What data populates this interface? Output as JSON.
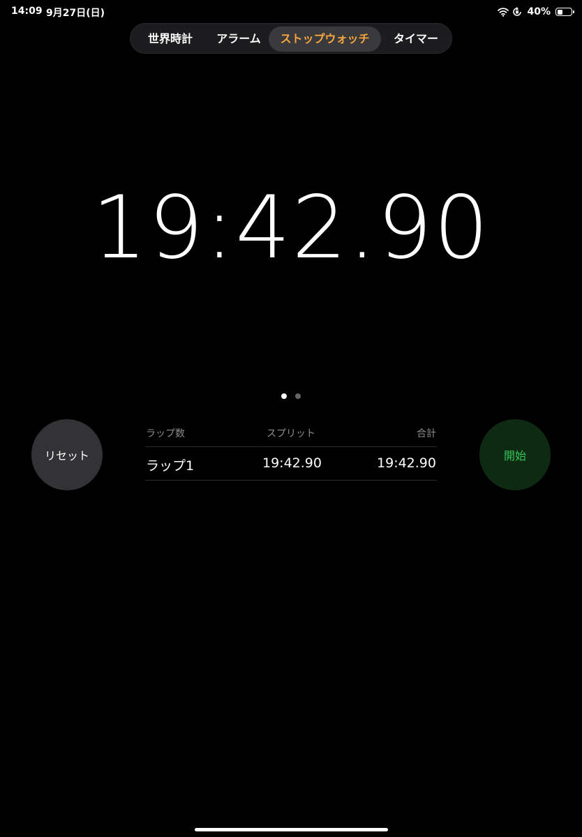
{
  "status_bar": {
    "time": "14:09",
    "date": "9月27日(日)",
    "battery_percent": "40%",
    "battery_level": 0.4,
    "icons": [
      "wifi-icon",
      "orientation-lock-icon",
      "battery-icon"
    ]
  },
  "tabs": [
    {
      "label": "世界時計",
      "selected": false
    },
    {
      "label": "アラーム",
      "selected": false
    },
    {
      "label": "ストップウォッチ",
      "selected": true
    },
    {
      "label": "タイマー",
      "selected": false
    }
  ],
  "colors": {
    "background": "#000000",
    "selected_tab_text": "#f7a541",
    "start_button_bg": "#0e2a12",
    "start_button_text": "#34c759",
    "reset_button_bg": "#333335"
  },
  "stopwatch": {
    "display": "19:42.90"
  },
  "page_indicator": {
    "count": 2,
    "active_index": 0
  },
  "buttons": {
    "reset_label": "リセット",
    "start_label": "開始"
  },
  "laps": {
    "headers": {
      "lap": "ラップ数",
      "split": "スプリット",
      "total": "合計"
    },
    "rows": [
      {
        "lap": "ラップ1",
        "split": "19:42.90",
        "total": "19:42.90"
      }
    ]
  }
}
